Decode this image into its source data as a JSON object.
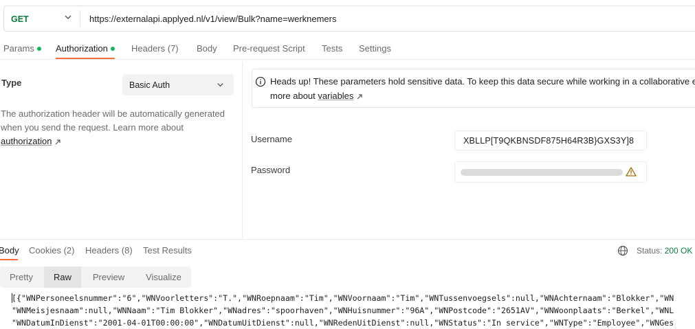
{
  "request": {
    "method": "GET",
    "url": "https://externalapi.applyed.nl/v1/view/Bulk?name=werknemers"
  },
  "tabs": [
    {
      "label": "Params",
      "dot": true
    },
    {
      "label": "Authorization",
      "dot": true,
      "active": true
    },
    {
      "label": "Headers (7)"
    },
    {
      "label": "Body"
    },
    {
      "label": "Pre-request Script"
    },
    {
      "label": "Tests"
    },
    {
      "label": "Settings"
    }
  ],
  "auth": {
    "type_label": "Type",
    "type_value": "Basic Auth",
    "description": "The authorization header will be automatically generated when you send the request. Learn more about",
    "description_link": "authorization",
    "info_line1": "Heads up! These parameters hold sensitive data. To keep this data secure while working in a collaborative en",
    "info_line2_prefix": "more about",
    "info_link": "variables",
    "username_label": "Username",
    "username_value": "XBLLP[T9QKBNSDF875H64R3B}GXS3Y]8",
    "password_label": "Password"
  },
  "response": {
    "tabs": [
      {
        "label": "Body",
        "active": true
      },
      {
        "label": "Cookies",
        "count": "(2)"
      },
      {
        "label": "Headers",
        "count": "(8)"
      },
      {
        "label": "Test Results"
      }
    ],
    "status_label": "Status:",
    "status_value": "200 OK",
    "views": [
      "Pretty",
      "Raw",
      "Preview",
      "Visualize"
    ],
    "active_view": "Raw",
    "lines": [
      "[{\"WNPersoneelsnummer\":\"6\",\"WNVoorletters\":\"T.\",\"WNRoepnaam\":\"Tim\",\"WNVoornaam\":\"Tim\",\"WNTussenvoegsels\":null,\"WNAchternaam\":\"Blokker\",\"WN",
      "\"WNMeisjesnaam\":null,\"WNNaam\":\"Tim Blokker\",\"WNadres\":\"spoorhaven\",\"WNHuisnummer\":\"96A\",\"WNPostcode\":\"2651AV\",\"WNWoonplaats\":\"Berkel\",\"WNL",
      "\"WNDatumInDienst\":\"2001-04-01T00:00:00\",\"WNDatumUitDienst\":null,\"WNRedenUitDienst\":null,\"WNStatus\":\"In service\",\"WNType\":\"Employee\",\"WNGes"
    ]
  },
  "colors": {
    "accent": "#ff6c37",
    "method_get": "#0a7e3b",
    "dot": "#0cbb52",
    "status_ok": "#0a7e3b"
  },
  "icons": [
    "chevron-down-icon",
    "info-icon",
    "external-link-icon",
    "warning-icon",
    "globe-icon"
  ]
}
